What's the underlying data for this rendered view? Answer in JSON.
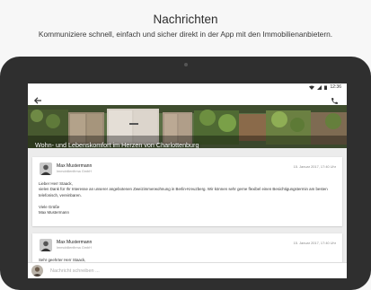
{
  "promo": {
    "title": "Nachrichten",
    "subtitle": "Kommuniziere schnell, einfach und sicher direkt in der App mit den Immobilienanbietern."
  },
  "status_bar": {
    "time": "12:36"
  },
  "app_bar": {
    "back_icon": "arrow-left-icon",
    "call_icon": "phone-icon"
  },
  "listing": {
    "title": "Wohn- und Lebenskomfort im Herzen von Charlottenburg"
  },
  "messages": [
    {
      "sender": "Max Mustermann",
      "company": "Immobilienfirma GmbH",
      "date": "15. Januar 2017, 17:40 Uhr",
      "greeting": "Lieber Herr Staack,",
      "text": "vielen Dank für Ihr Interesse an unserer angebotenen Zweizimmerwohnung in Berlin-Kreuzberg. Wir können sehr gerne flexibel einen Besichtigungstermin am besten telefonisch, vereinbaren.",
      "closing": "Viele Grüße",
      "signature": "Max Mustermann"
    },
    {
      "sender": "Max Mustermann",
      "company": "Immobilienfirma GmbH",
      "date": "15. Januar 2017, 17:40 Uhr",
      "greeting": "Sehr geehrter Herr Staack,"
    }
  ],
  "composer": {
    "placeholder": "Nachricht schreiben ..."
  },
  "colors": {
    "tablet_bezel": "#2f2f2f",
    "thread_background": "#ececec"
  }
}
